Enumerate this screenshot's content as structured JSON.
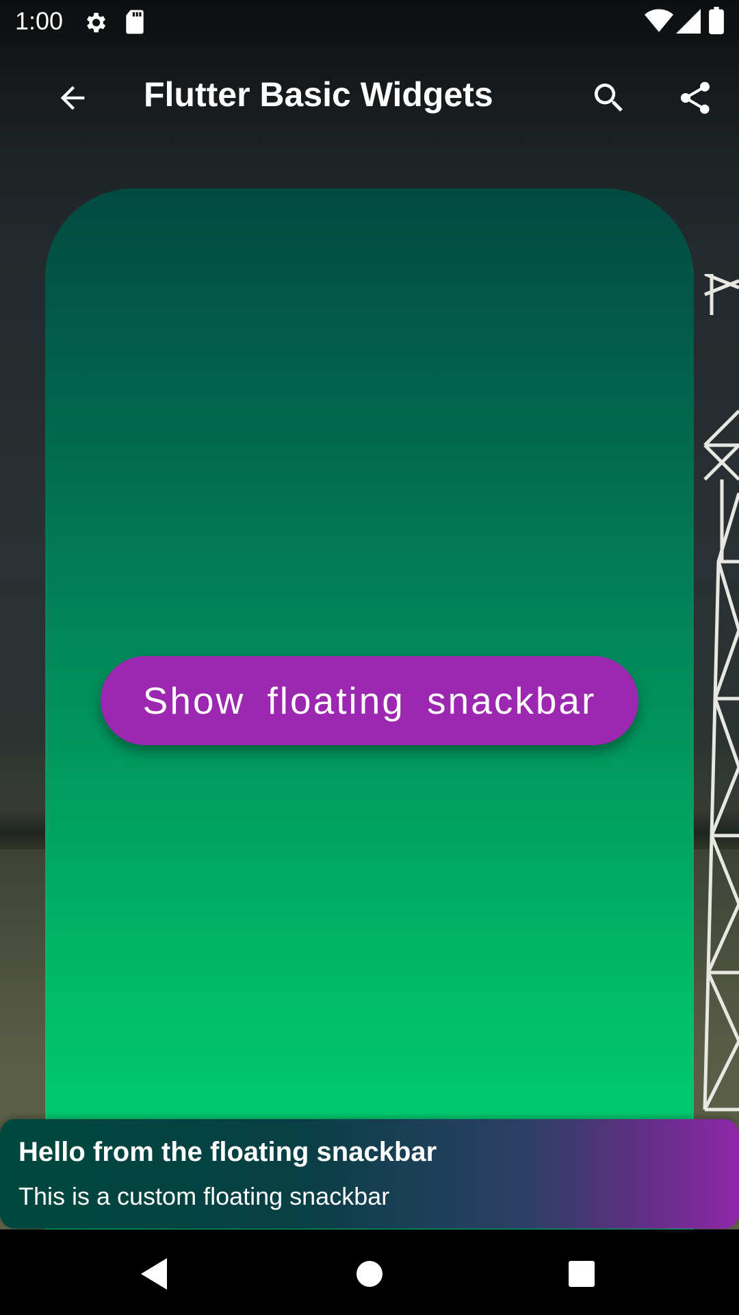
{
  "status_bar": {
    "time": "1:00",
    "icons": [
      "settings-icon",
      "sd-card-icon",
      "wifi-icon",
      "signal-icon",
      "battery-icon"
    ]
  },
  "app_bar": {
    "title": "Flutter Basic Widgets",
    "back_icon": "arrow-back-icon",
    "actions": [
      "search-icon",
      "share-icon"
    ]
  },
  "main": {
    "button_label": "Show floating snackbar"
  },
  "snackbar": {
    "title": "Hello from the floating snackbar",
    "message": "This is a custom floating snackbar"
  },
  "nav_bar": {
    "buttons": [
      "back-triangle-icon",
      "home-circle-icon",
      "recents-square-icon"
    ]
  },
  "colors": {
    "button": "#9c27b0",
    "card_top": "#024a40",
    "card_bottom": "#00d673",
    "snackbar_start": "#00483e",
    "snackbar_end": "#8e27a8"
  }
}
